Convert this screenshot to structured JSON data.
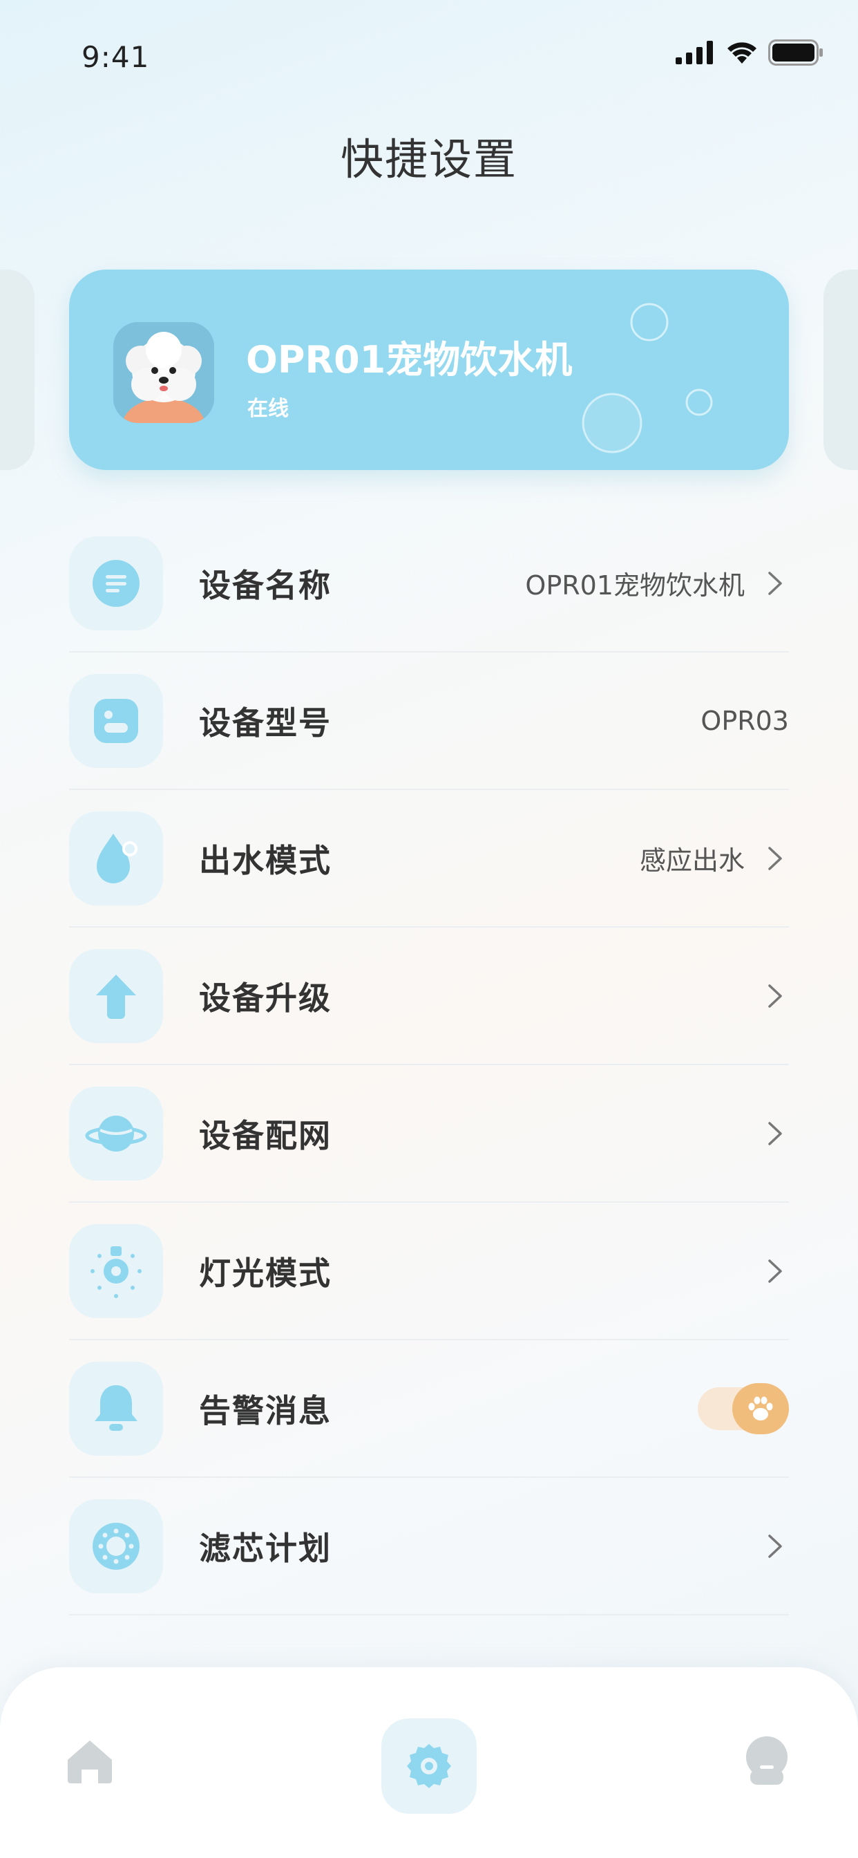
{
  "status_bar": {
    "time": "9:41"
  },
  "header": {
    "title": "快捷设置"
  },
  "device": {
    "name": "OPR01宠物饮水机",
    "status": "在线"
  },
  "settings": [
    {
      "label": "设备名称",
      "value": "OPR01宠物饮水机",
      "icon": "list-icon",
      "chevron": true
    },
    {
      "label": "设备型号",
      "value": "OPR03",
      "icon": "device-icon",
      "chevron": false
    },
    {
      "label": "出水模式",
      "value": "感应出水",
      "icon": "water-drop-icon",
      "chevron": true
    },
    {
      "label": "设备升级",
      "value": "",
      "icon": "upgrade-arrow-icon",
      "chevron": true
    },
    {
      "label": "设备配网",
      "value": "",
      "icon": "planet-icon",
      "chevron": true
    },
    {
      "label": "灯光模式",
      "value": "",
      "icon": "light-icon",
      "chevron": true
    },
    {
      "label": "告警消息",
      "value": "",
      "icon": "bell-icon",
      "toggle_on": true
    },
    {
      "label": "滤芯计划",
      "value": "",
      "icon": "filter-icon",
      "chevron": true
    }
  ],
  "tab_bar": {
    "items": [
      {
        "name": "home",
        "icon": "home-icon",
        "active": false
      },
      {
        "name": "settings",
        "icon": "gear-icon",
        "active": true
      },
      {
        "name": "profile",
        "icon": "user-icon",
        "active": false
      }
    ]
  },
  "colors": {
    "accent": "#8fd7ee",
    "icon_bg": "#e6f4f9",
    "toggle_on": "#f0bd7c",
    "toggle_track": "#f7e7d4",
    "inactive_icon": "#cfd4d7"
  }
}
